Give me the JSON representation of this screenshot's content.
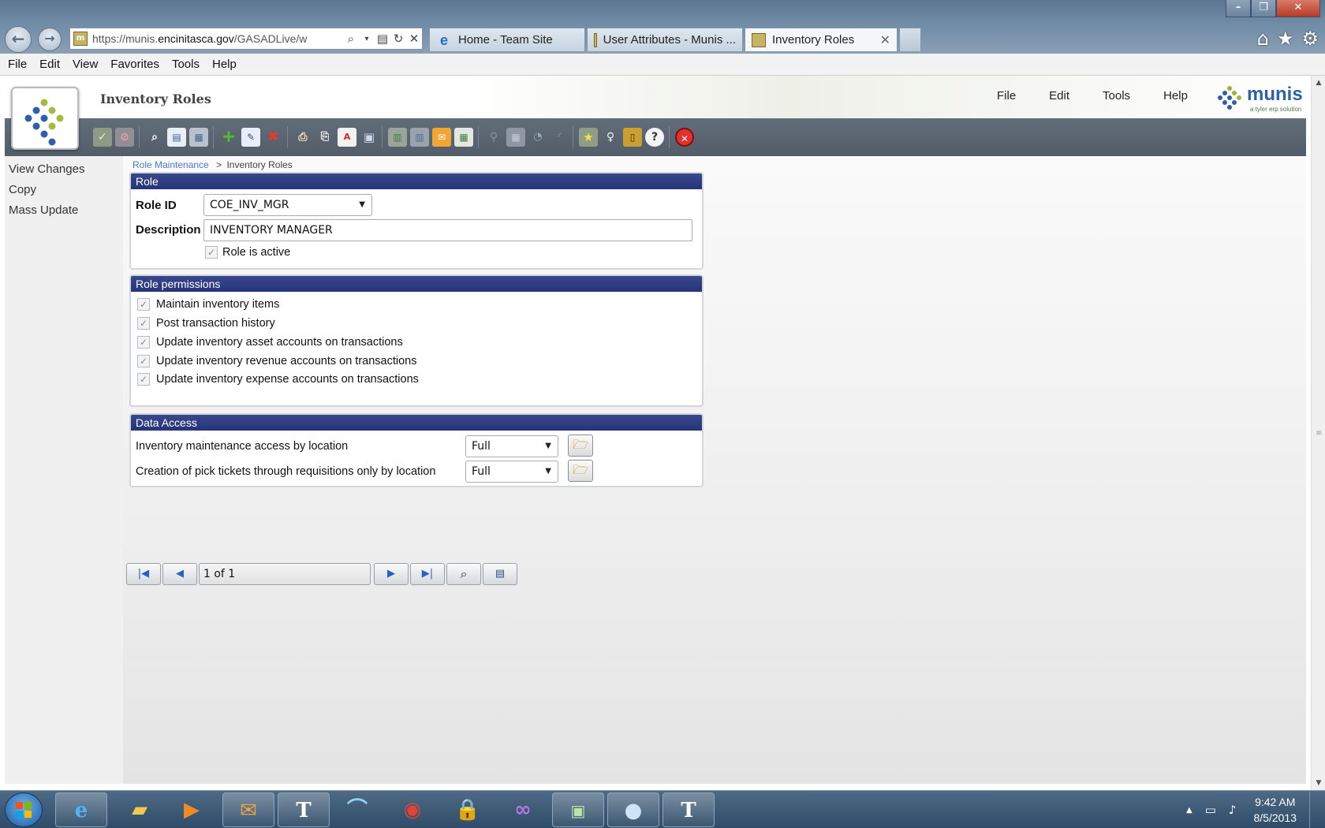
{
  "browser": {
    "address": {
      "prefix": "https://munis.",
      "domain": "encinitasca.gov",
      "path": "/GASADLive/w"
    },
    "tabs": [
      {
        "label": "Home - Team Site"
      },
      {
        "label": "User Attributes - Munis ..."
      },
      {
        "label": "Inventory Roles"
      }
    ],
    "menu": [
      "File",
      "Edit",
      "View",
      "Favorites",
      "Tools",
      "Help"
    ]
  },
  "app": {
    "title": "Inventory Roles",
    "menu": [
      "File",
      "Edit",
      "Tools",
      "Help"
    ],
    "logo_text": "munis",
    "logo_tagline": "a tyler erp solution"
  },
  "left_panel": {
    "items": [
      "View Changes",
      "Copy",
      "Mass Update"
    ]
  },
  "breadcrumb": {
    "link": "Role Maintenance",
    "separator": ">",
    "current": "Inventory Roles"
  },
  "role": {
    "heading": "Role",
    "role_id_label": "Role ID",
    "role_id_value": "COE_INV_MGR",
    "description_label": "Description",
    "description_value": "INVENTORY MANAGER",
    "active_label": "Role is active",
    "active_checked": true
  },
  "permissions": {
    "heading": "Role permissions",
    "items": [
      {
        "label": "Maintain inventory items",
        "checked": true
      },
      {
        "label": "Post transaction history",
        "checked": true
      },
      {
        "label": "Update inventory asset accounts on transactions",
        "checked": true
      },
      {
        "label": "Update inventory revenue accounts on transactions",
        "checked": true
      },
      {
        "label": "Update inventory expense accounts on transactions",
        "checked": true
      }
    ]
  },
  "data_access": {
    "heading": "Data Access",
    "rows": [
      {
        "label": "Inventory maintenance access by location",
        "value": "Full"
      },
      {
        "label": "Creation of pick tickets through requisitions only by location",
        "value": "Full"
      }
    ]
  },
  "pager": {
    "text": "1 of 1"
  },
  "taskbar": {
    "time": "9:42 AM",
    "date": "8/5/2013"
  },
  "colors": {
    "panel_header": "#2f3d82",
    "toolbar": "#5b6572",
    "link": "#4a7ec2"
  }
}
